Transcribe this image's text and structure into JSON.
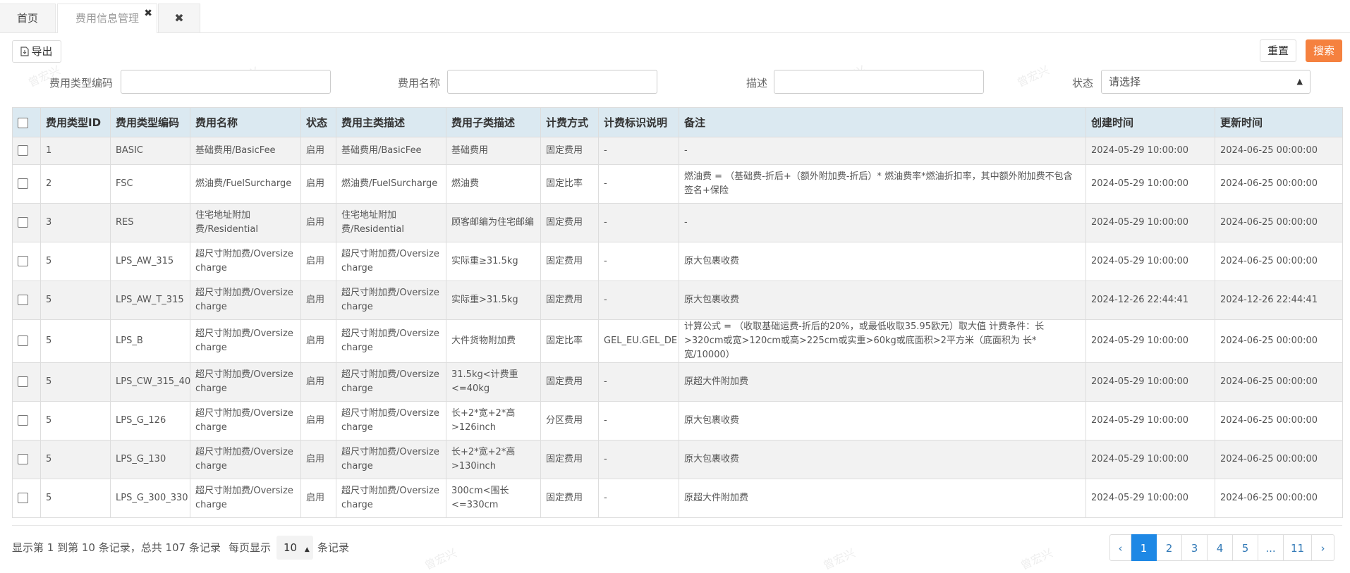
{
  "tabs": [
    {
      "label": "首页"
    },
    {
      "label": "费用信息管理",
      "close": "✖"
    },
    {
      "label": "✖"
    }
  ],
  "toolbar": {
    "export_label": "导出",
    "reset_label": "重置",
    "search_label": "搜索"
  },
  "filters": {
    "code_label": "费用类型编码",
    "name_label": "费用名称",
    "desc_label": "描述",
    "status_label": "状态",
    "status_value": "请选择"
  },
  "table": {
    "headers": [
      "费用类型ID",
      "费用类型编码",
      "费用名称",
      "状态",
      "费用主类描述",
      "费用子类描述",
      "计费方式",
      "计费标识说明",
      "备注",
      "创建时间",
      "更新时间"
    ],
    "rows": [
      [
        "1",
        "BASIC",
        "基础费用/BasicFee",
        "启用",
        "基础费用/BasicFee",
        "基础费用",
        "固定费用",
        "-",
        "-",
        "2024-05-29 10:00:00",
        "2024-06-25 00:00:00"
      ],
      [
        "2",
        "FSC",
        "燃油费/FuelSurcharge",
        "启用",
        "燃油费/FuelSurcharge",
        "燃油费",
        "固定比率",
        "-",
        "燃油费 = （基础费-折后+（额外附加费-折后）* 燃油费率*燃油折扣率，其中额外附加费不包含签名+保险",
        "2024-05-29 10:00:00",
        "2024-06-25 00:00:00"
      ],
      [
        "3",
        "RES",
        "住宅地址附加费/Residential",
        "启用",
        "住宅地址附加费/Residential",
        "顾客邮编为住宅邮编",
        "固定费用",
        "-",
        "-",
        "2024-05-29 10:00:00",
        "2024-06-25 00:00:00"
      ],
      [
        "5",
        "LPS_AW_315",
        "超尺寸附加费/Oversize charge",
        "启用",
        "超尺寸附加费/Oversize charge",
        "实际重≥31.5kg",
        "固定费用",
        "-",
        "原大包裹收费",
        "2024-05-29 10:00:00",
        "2024-06-25 00:00:00"
      ],
      [
        "5",
        "LPS_AW_T_315",
        "超尺寸附加费/Oversize charge",
        "启用",
        "超尺寸附加费/Oversize charge",
        "实际重>31.5kg",
        "固定费用",
        "-",
        "原大包裹收费",
        "2024-12-26 22:44:41",
        "2024-12-26 22:44:41"
      ],
      [
        "5",
        "LPS_B",
        "超尺寸附加费/Oversize charge",
        "启用",
        "超尺寸附加费/Oversize charge",
        "大件货物附加费",
        "固定比率",
        "GEL_EU.GEL_DE",
        "计算公式 = （收取基础运费-折后的20%，或最低收取35.95欧元）取大值 计费条件：长>320cm或宽>120cm或高>225cm或实重>60kg或底面积>2平方米（底面积为 长*宽/10000）",
        "2024-05-29 10:00:00",
        "2024-06-25 00:00:00"
      ],
      [
        "5",
        "LPS_CW_315_40",
        "超尺寸附加费/Oversize charge",
        "启用",
        "超尺寸附加费/Oversize charge",
        "31.5kg<计费重<=40kg",
        "固定费用",
        "-",
        "原超大件附加费",
        "2024-05-29 10:00:00",
        "2024-06-25 00:00:00"
      ],
      [
        "5",
        "LPS_G_126",
        "超尺寸附加费/Oversize charge",
        "启用",
        "超尺寸附加费/Oversize charge",
        "长+2*宽+2*高>126inch",
        "分区费用",
        "-",
        "原大包裹收费",
        "2024-05-29 10:00:00",
        "2024-06-25 00:00:00"
      ],
      [
        "5",
        "LPS_G_130",
        "超尺寸附加费/Oversize charge",
        "启用",
        "超尺寸附加费/Oversize charge",
        "长+2*宽+2*高>130inch",
        "固定费用",
        "-",
        "原大包裹收费",
        "2024-05-29 10:00:00",
        "2024-06-25 00:00:00"
      ],
      [
        "5",
        "LPS_G_300_330",
        "超尺寸附加费/Oversize charge",
        "启用",
        "超尺寸附加费/Oversize charge",
        "300cm<围长<=330cm",
        "固定费用",
        "-",
        "原超大件附加费",
        "2024-05-29 10:00:00",
        "2024-06-25 00:00:00"
      ]
    ]
  },
  "footer": {
    "info": "显示第 1 到第 10 条记录，总共 107 条记录",
    "per_page_prefix": "每页显示",
    "page_size": "10",
    "per_page_suffix": "条记录"
  },
  "pagination": {
    "prev": "‹",
    "pages": [
      "1",
      "2",
      "3",
      "4",
      "5",
      "...",
      "11"
    ],
    "next": "›",
    "active": "1"
  },
  "watermark": "曾宏兴",
  "colors": {
    "accent": "#f5813f",
    "header_bg": "#dbe9f1",
    "active_page": "#1e88e5"
  }
}
